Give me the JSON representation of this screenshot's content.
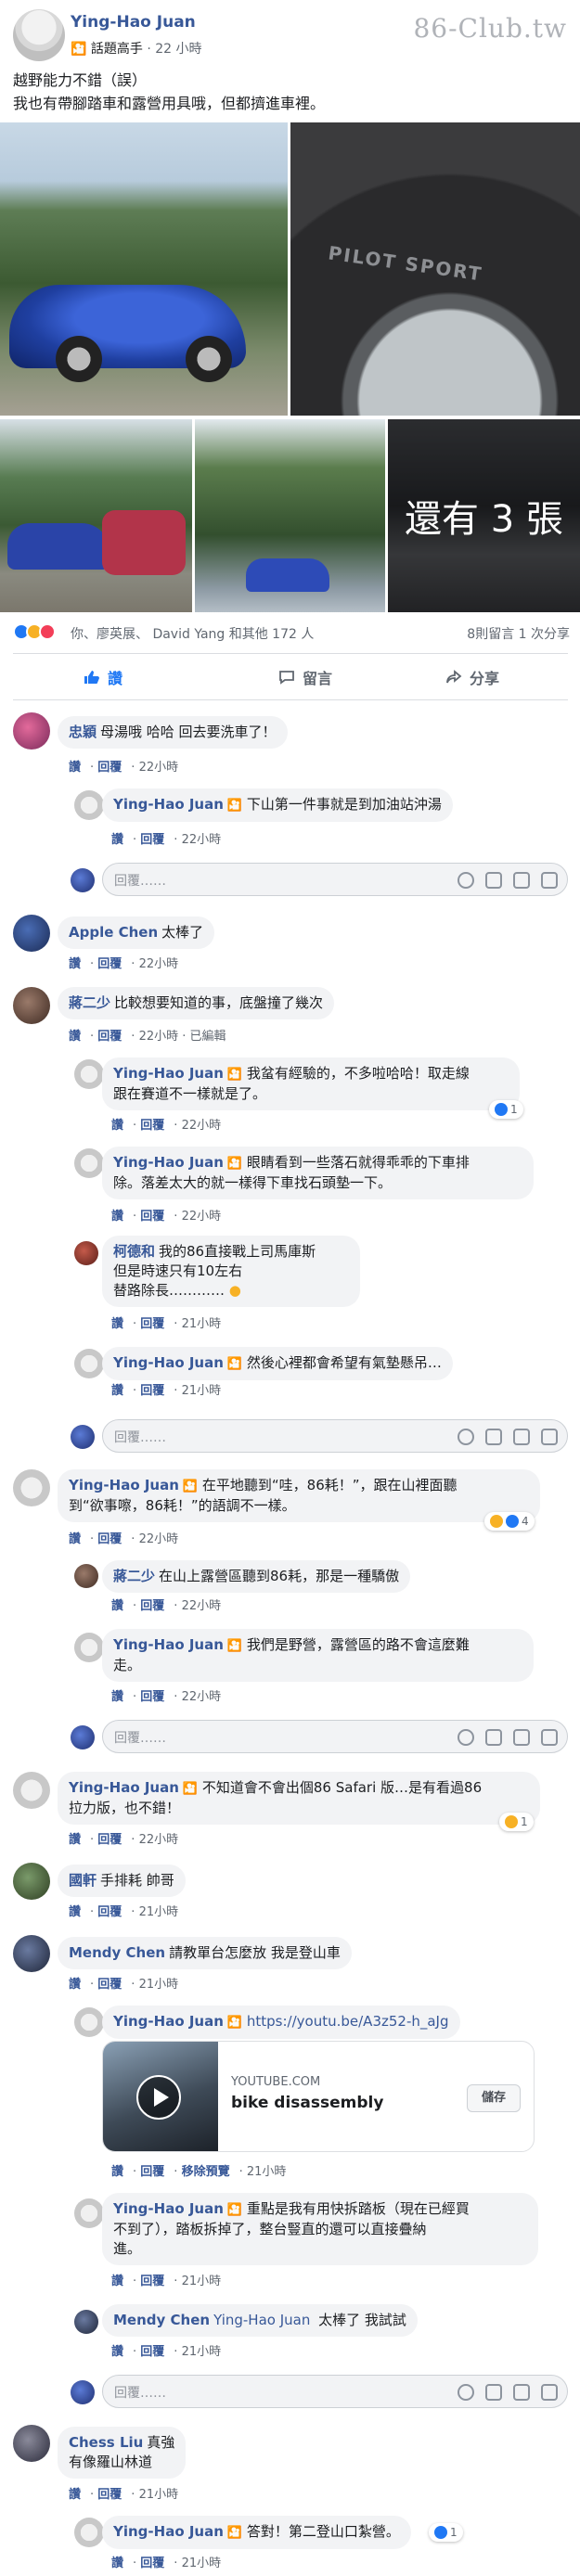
{
  "post": {
    "author": "Ying-Hao Juan",
    "badge": "話題高手",
    "time": "22 小時",
    "watermark": "86-Club.tw",
    "text_line1": "越野能力不錯（誤）",
    "text_line2": "我也有帶腳踏車和露營用具哦，但都擠進車裡。",
    "more_photos": "還有 3 張",
    "tire_text": "PILOT SPORT"
  },
  "reactions": {
    "icons": [
      "like-icon",
      "wow-icon",
      "love-icon"
    ],
    "names": "你、廖英展、 David Yang 和其他 172 人",
    "counts": "8則留言 1 次分享"
  },
  "actions": {
    "like": "讚",
    "comment": "留言",
    "share": "分享"
  },
  "ui": {
    "like": "讚",
    "reply": "回覆",
    "reply_placeholder": "回覆……",
    "edited": "已編輯",
    "remove_preview": "移除預覽",
    "badge_icon": "🎦"
  },
  "comments": [
    {
      "name": "忠穎",
      "text": "母湯哦 哈哈 回去要洗車了！",
      "time": "22小時"
    },
    {
      "name": "Ying-Hao Juan",
      "text": "下山第一件事就是到加油站沖湯",
      "time": "22小時"
    },
    {
      "name": "Apple Chen",
      "text": "太棒了",
      "time": "22小時"
    },
    {
      "name": "蔣二少",
      "text": "比較想要知道的事，底盤撞了幾次",
      "time": "22小時"
    },
    {
      "name": "Ying-Hao Juan",
      "text_line1": "我蚠有經驗的，不多啦哈哈！取走線",
      "text_line2": "跟在賽道不一樣就是了。",
      "time": "22小時",
      "reactions": "1"
    },
    {
      "name": "Ying-Hao Juan",
      "text_line1": "眼睛看到一些落石就得乖乖的下車排",
      "text_line2": "除。落差太大的就一樣得下車找石頭墊一下。",
      "time": "22小時"
    },
    {
      "name": "柯德和",
      "text_line1": "我的86直接戰上司馬庫斯",
      "text_line2": "但是時速只有10左右",
      "text_line3": "替路除長…………",
      "time": "21小時"
    },
    {
      "name": "Ying-Hao Juan",
      "text": "然後心裡都會希望有氣墊懸吊…",
      "time": "21小時"
    },
    {
      "name": "Ying-Hao Juan",
      "text_line1": "在平地聽到“哇，86耗！”，跟在山裡面聽",
      "text_line2": "到“欲事嚓，86耗！”的語調不一樣。",
      "time": "22小時",
      "reactions": "4"
    },
    {
      "name": "蔣二少",
      "text": "在山上露營區聽到86耗，那是一種驕傲",
      "time": "22小時"
    },
    {
      "name": "Ying-Hao Juan",
      "text_line1": "我們是野營，露營區的路不會這麼難",
      "text_line2": "走。",
      "time": "22小時"
    },
    {
      "name": "Ying-Hao Juan",
      "text_line1": "不知道會不會出個86 Safari 版…是有看過86",
      "text_line2": "拉力版，也不錯！",
      "time": "22小時",
      "reactions": "1"
    },
    {
      "name": "國軒",
      "text": "手排耗 帥哥",
      "time": "21小時"
    },
    {
      "name": "Mendy Chen",
      "text": "請教單台怎麼放 我是登山車",
      "time": "21小時"
    },
    {
      "name": "Ying-Hao Juan",
      "text": "https://youtu.be/A3z52-h_aJg",
      "time": "21小時"
    },
    {
      "name": "Ying-Hao Juan",
      "text_line1": "重點是我有用快拆踏板（現在已經買",
      "text_line2": "不到了），踏板拆掉了，整台豎直的還可以直接疊納",
      "text_line3": "進。",
      "time": "21小時"
    },
    {
      "name": "Mendy Chen",
      "tag": "Ying-Hao Juan",
      "text": "太棒了 我試試",
      "time": "21小時"
    },
    {
      "name": "Chess Liu",
      "text_line1": "真強",
      "text_line2": "有像羅山林道",
      "time": "21小時"
    },
    {
      "name": "Ying-Hao Juan",
      "text": "答對！第二登山口紮營。",
      "time": "21小時",
      "reactions": "1"
    }
  ],
  "link_card": {
    "domain": "YOUTUBE.COM",
    "title": "bike disassembly",
    "save": "儲存"
  }
}
